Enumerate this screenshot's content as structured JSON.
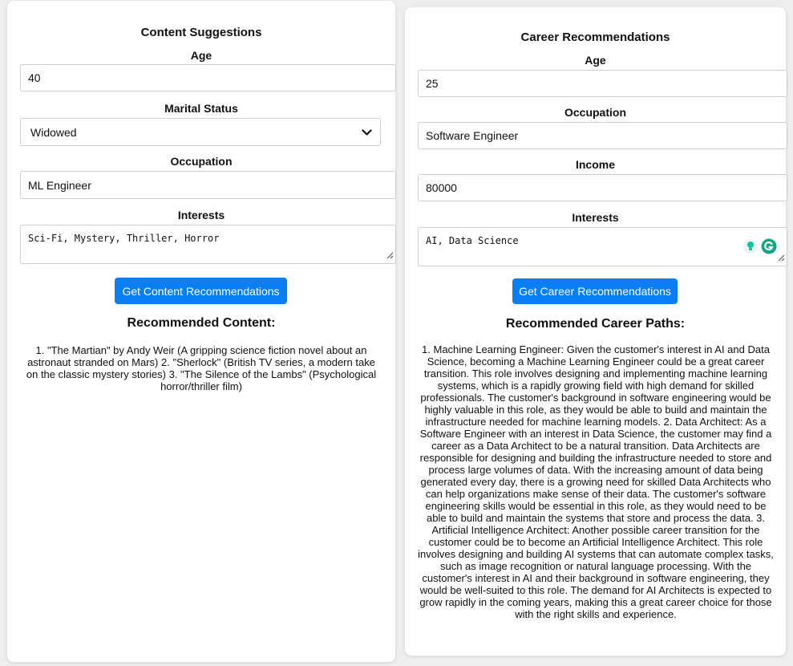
{
  "content_form": {
    "title": "Content Suggestions",
    "age_label": "Age",
    "age_value": "40",
    "marital_label": "Marital Status",
    "marital_value": "Widowed",
    "occupation_label": "Occupation",
    "occupation_value": "ML Engineer",
    "interests_label": "Interests",
    "interests_value": "Sci-Fi, Mystery, Thriller, Horror",
    "button_label": "Get Content Recommendations",
    "result_heading": "Recommended Content:",
    "result_text": "1. \"The Martian\" by Andy Weir (A gripping science fiction novel about an astronaut stranded on Mars) 2. \"Sherlock\" (British TV series, a modern take on the classic mystery stories) 3. \"The Silence of the Lambs\" (Psychological horror/thriller film)"
  },
  "career_form": {
    "title": "Career Recommendations",
    "age_label": "Age",
    "age_value": "25",
    "occupation_label": "Occupation",
    "occupation_value": "Software Engineer",
    "income_label": "Income",
    "income_value": "80000",
    "interests_label": "Interests",
    "interests_value": "AI, Data Science",
    "button_label": "Get Career Recommendations",
    "result_heading": "Recommended Career Paths:",
    "result_text": "1. Machine Learning Engineer: Given the customer's interest in AI and Data Science, becoming a Machine Learning Engineer could be a great career transition. This role involves designing and implementing machine learning systems, which is a rapidly growing field with high demand for skilled professionals. The customer's background in software engineering would be highly valuable in this role, as they would be able to build and maintain the infrastructure needed for machine learning models. 2. Data Architect: As a Software Engineer with an interest in Data Science, the customer may find a career as a Data Architect to be a natural transition. Data Architects are responsible for designing and building the infrastructure needed to store and process large volumes of data. With the increasing amount of data being generated every day, there is a growing need for skilled Data Architects who can help organizations make sense of their data. The customer's software engineering skills would be essential in this role, as they would need to be able to build and maintain the systems that store and process the data. 3. Artificial Intelligence Architect: Another possible career transition for the customer could be to become an Artificial Intelligence Architect. This role involves designing and building AI systems that can automate complex tasks, such as image recognition or natural language processing. With the customer's interest in AI and their background in software engineering, they would be well-suited to this role. The demand for AI Architects is expected to grow rapidly in the coming years, making this a great career choice for those with the right skills and experience."
  },
  "colors": {
    "button": "#0a7ff3",
    "background": "#eeeeee",
    "card": "#ffffff"
  },
  "icons": [
    "chevron-down-icon",
    "resize-grip-icon",
    "grammarly-bulb-icon",
    "grammarly-g-icon"
  ]
}
